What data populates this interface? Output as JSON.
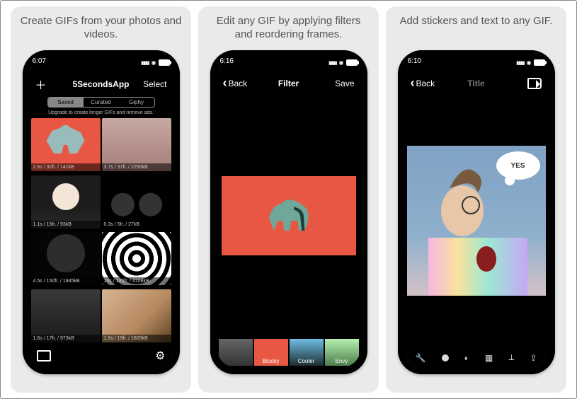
{
  "slides": [
    {
      "caption": "Create GIFs from your photos and videos.",
      "time": "6:07",
      "title": "5SecondsApp",
      "left_action": "+",
      "right_action": "Select",
      "segments": [
        "Saved",
        "Curated",
        "Giphy"
      ],
      "banner": "Upgrade to create longer GIFs and remove ads.",
      "tiles": [
        "2.6s / 32fr. / 141kB",
        "3.7s / 37fr. / 2256kB",
        "1.1s / 15fr. / 93kB",
        "0.3s / 5fr. / 27kB",
        "4.5s / 150fr. / 1945kB",
        "15s / 135fr. / 4108kB",
        "1.6s / 17fr. / 973kB",
        "1.9s / 19fr. / 1809kB"
      ]
    },
    {
      "caption": "Edit any GIF by applying filters and reordering frames.",
      "time": "6:16",
      "title": "Filter",
      "back": "Back",
      "save": "Save",
      "filters": [
        "",
        "Blocky",
        "Cooler",
        "Envy"
      ]
    },
    {
      "caption": "Add stickers and text to any GIF.",
      "time": "6:10",
      "title": "Title",
      "back": "Back",
      "bubble": "YES"
    }
  ]
}
